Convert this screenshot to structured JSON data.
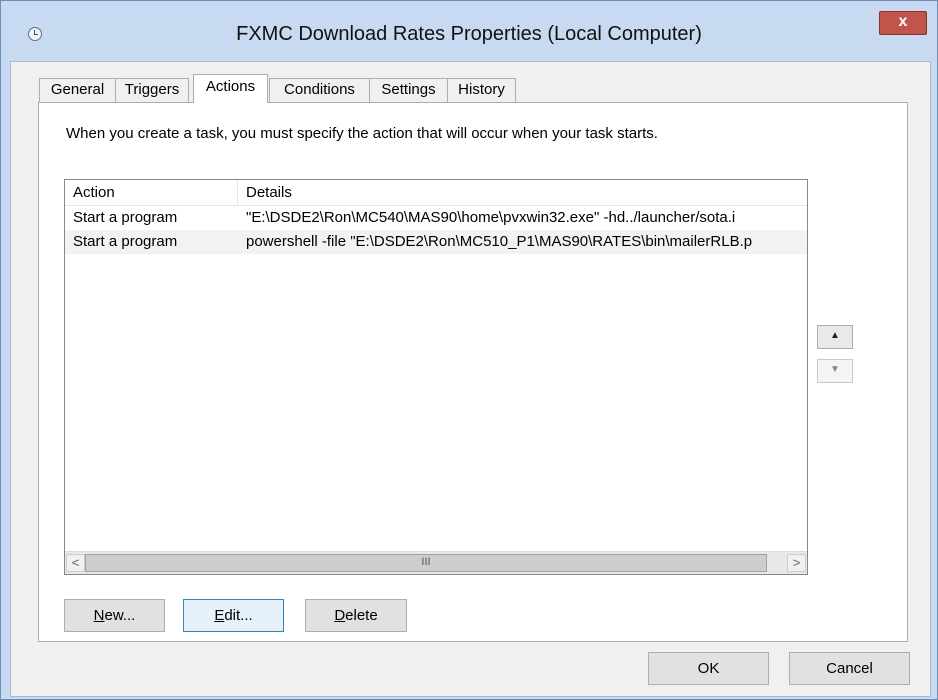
{
  "window": {
    "title": "FXMC Download Rates Properties (Local Computer)",
    "close_label": "x"
  },
  "tabs": [
    {
      "label": "General"
    },
    {
      "label": "Triggers"
    },
    {
      "label": "Actions",
      "selected": true
    },
    {
      "label": "Conditions"
    },
    {
      "label": "Settings"
    },
    {
      "label": "History"
    }
  ],
  "actions_panel": {
    "info_text": "When you create a task, you must specify the action that will occur when your task starts.",
    "columns": [
      "Action",
      "Details"
    ],
    "rows": [
      {
        "action": "Start a program",
        "details": "\"E:\\DSDE2\\Ron\\MC540\\MAS90\\home\\pvxwin32.exe\" -hd../launcher/sota.i"
      },
      {
        "action": "Start a program",
        "details": "powershell -file \"E:\\DSDE2\\Ron\\MC510_P1\\MAS90\\RATES\\bin\\mailerRLB.p"
      }
    ],
    "scrollbar": {
      "left_arrow": "<",
      "right_arrow": ">",
      "thumb_grip": "III"
    },
    "move_up_glyph": "▲",
    "move_down_glyph": "▼",
    "buttons": {
      "new": {
        "mnemonic": "N",
        "rest": "ew..."
      },
      "edit": {
        "mnemonic": "E",
        "rest": "dit..."
      },
      "delete": {
        "mnemonic": "D",
        "rest": "elete"
      }
    }
  },
  "dialog_buttons": {
    "ok": "OK",
    "cancel": "Cancel"
  },
  "colors": {
    "frame": "#c7daf1",
    "close_button": "#c2554b",
    "client": "#f0f0f0",
    "panel": "#ffffff",
    "focus_border": "#3c7fb1"
  }
}
